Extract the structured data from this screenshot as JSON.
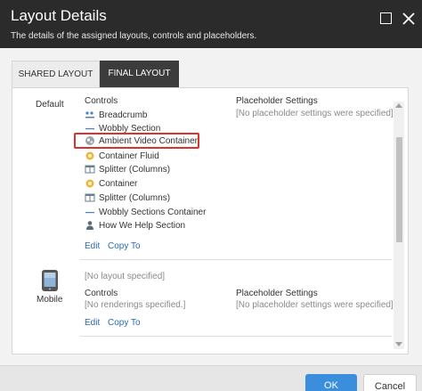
{
  "dialog": {
    "title": "Layout Details",
    "subtitle": "The details of the assigned layouts, controls and placeholders."
  },
  "tabs": [
    {
      "label": "SHARED LAYOUT"
    },
    {
      "label": "FINAL LAYOUT"
    }
  ],
  "default_device": {
    "label": "Default",
    "controls_header": "Controls",
    "placeholder_header": "Placeholder Settings",
    "placeholder_empty": "[No placeholder settings were specified]",
    "controls": [
      {
        "label": "Breadcrumb",
        "icon": "breadcrumb-icon"
      },
      {
        "label": "Wobbly Section",
        "icon": "dash-icon"
      },
      {
        "label": "Ambient Video Container",
        "icon": "video-container-icon"
      },
      {
        "label": "Container Fluid",
        "icon": "container-icon"
      },
      {
        "label": "Splitter (Columns)",
        "icon": "splitter-icon"
      },
      {
        "label": "Container",
        "icon": "container-icon"
      },
      {
        "label": "Splitter (Columns)",
        "icon": "splitter-icon"
      },
      {
        "label": "Wobbly Sections Container",
        "icon": "dash-icon"
      },
      {
        "label": "How We Help Section",
        "icon": "person-icon"
      }
    ],
    "edit_label": "Edit",
    "copy_label": "Copy To"
  },
  "mobile_device": {
    "label": "Mobile",
    "layout_empty": "[No layout specified]",
    "controls_header": "Controls",
    "controls_empty": "[No renderings specified.]",
    "placeholder_header": "Placeholder Settings",
    "placeholder_empty": "[No placeholder settings were specified]",
    "edit_label": "Edit",
    "copy_label": "Copy To"
  },
  "footer": {
    "ok_label": "OK",
    "cancel_label": "Cancel"
  },
  "colors": {
    "titlebar": "#2b2b2b",
    "link": "#2a6ab5",
    "highlight": "#d9342b",
    "primary_button": "#3a8edc"
  }
}
